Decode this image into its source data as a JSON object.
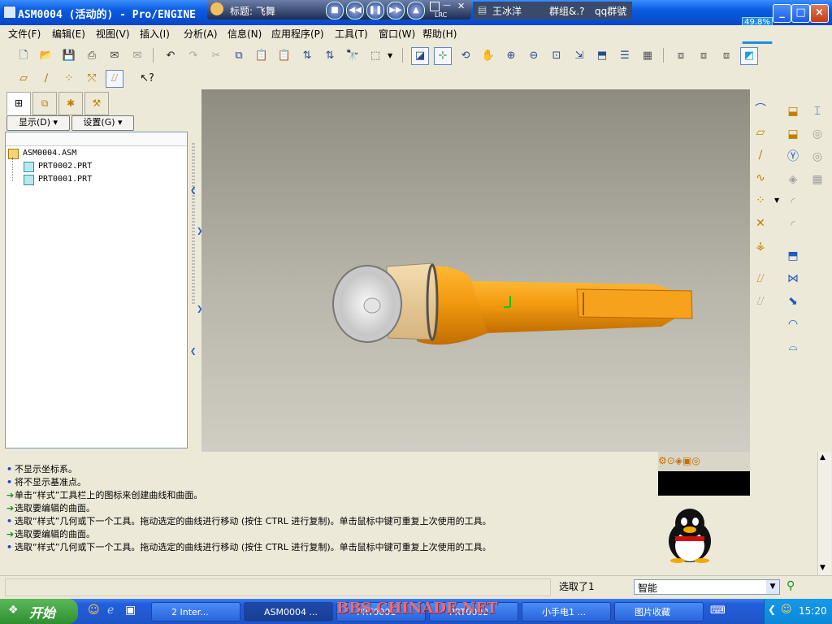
{
  "window": {
    "title": "ASM0004 (活动的) - Pro/ENGINE"
  },
  "media_overlay": {
    "caption": "标题: 飞舞",
    "lrc": "LRC"
  },
  "im_bar": {
    "name": "王冰洋",
    "group": "群组&.?",
    "qq": "qq群號"
  },
  "zoom_badge": "49.8%",
  "menu": [
    "文件(F)",
    "编辑(E)",
    "视图(V)",
    "插入(I)",
    "分析(A)",
    "信息(N)",
    "应用程序(P)",
    "工具(T)",
    "窗口(W)",
    "帮助(H)"
  ],
  "left_panel": {
    "show_button": "显示(D)",
    "settings_button": "设置(G)",
    "tree": [
      {
        "label": "ASM0004.ASM",
        "level": 0
      },
      {
        "label": "PRT0002.PRT",
        "level": 1
      },
      {
        "label": "PRT0001.PRT",
        "level": 1
      }
    ]
  },
  "messages": [
    {
      "kind": "info",
      "text": "不显示坐标系。"
    },
    {
      "kind": "info",
      "text": "将不显示基准点。"
    },
    {
      "kind": "prompt",
      "text": "单击“样式”工具栏上的图标来创建曲线和曲面。"
    },
    {
      "kind": "prompt",
      "text": "选取要编辑的曲面。"
    },
    {
      "kind": "info",
      "text": "选取“样式”几何或下一个工具。拖动选定的曲线进行移动 (按住 CTRL 进行复制)。单击鼠标中键可重复上次使用的工具。"
    },
    {
      "kind": "prompt",
      "text": "选取要编辑的曲面。"
    },
    {
      "kind": "info",
      "text": "选取“样式”几何或下一个工具。拖动选定的曲线进行移动 (按住 CTRL 进行复制)。单击鼠标中键可重复上次使用的工具。"
    }
  ],
  "status": {
    "selected": "选取了1",
    "filter": "智能"
  },
  "taskbar": {
    "start": "开始",
    "tasks": [
      "2 Inter...",
      "ASM0004 ...",
      "PRT0001",
      "PRT0002",
      "小手电1 ...",
      "图片收藏"
    ],
    "clock": "15:20",
    "watermark": "BBS.CHINADE.NET"
  },
  "colors": {
    "model_orange": "#f39a10",
    "viewport_top": "#8e8c80",
    "taskbar_blue": "#245edb"
  }
}
